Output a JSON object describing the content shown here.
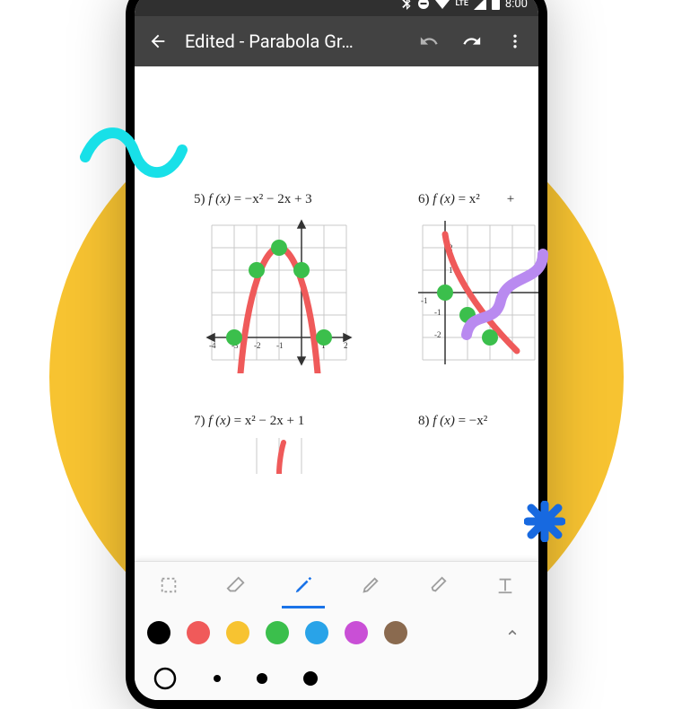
{
  "status": {
    "time": "8:00",
    "network": "LTE"
  },
  "appbar": {
    "title": "Edited - Parabola Gr…"
  },
  "problems": {
    "p5": {
      "num": "5)",
      "fx": "f (x)",
      "eq": " = −x² − 2x + 3"
    },
    "p6": {
      "num": "6)",
      "fx": "f (x)",
      "eq": " = x²"
    },
    "p6tail": " +",
    "p7": {
      "num": "7)",
      "fx": "f (x)",
      "eq": " = x² − 2x + 1"
    },
    "p8": {
      "num": "8)",
      "fx": "f (x)",
      "eq": " = −x²"
    }
  },
  "colors": {
    "palette": [
      "#000000",
      "#f05a5a",
      "#f7c331",
      "#3bbf4c",
      "#29a3e8",
      "#c94fd6",
      "#8a6a4f"
    ]
  },
  "chart_data": [
    {
      "type": "scatter",
      "title": "f(x) = -x^2 - 2x + 3",
      "xlim": [
        -4,
        2
      ],
      "ylim": [
        -1,
        5
      ],
      "series": [
        {
          "name": "points",
          "x": [
            -3,
            -2,
            -1,
            0,
            1
          ],
          "y": [
            0,
            3,
            4,
            3,
            0
          ]
        }
      ]
    },
    {
      "type": "scatter",
      "title": "f(x) = x^2 … (partial)",
      "xlim": [
        -1,
        2
      ],
      "ylim": [
        -2,
        2
      ],
      "series": [
        {
          "name": "points",
          "x": [
            0,
            1,
            2
          ],
          "y": [
            0,
            -1,
            -2
          ]
        }
      ]
    }
  ]
}
